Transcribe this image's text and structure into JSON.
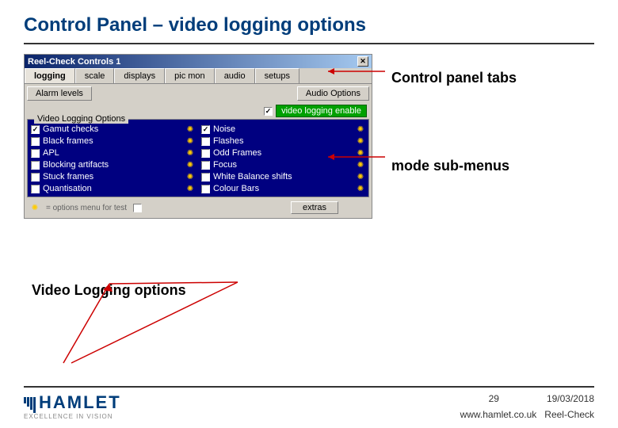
{
  "title": "Control Panel – video logging options",
  "window": {
    "title": "Reel-Check Controls 1",
    "close": "✕"
  },
  "tabs": [
    "logging",
    "scale",
    "displays",
    "pic mon",
    "audio",
    "setups"
  ],
  "active_tab_index": 0,
  "sub_buttons": {
    "alarm": "Alarm levels",
    "audio": "Audio Options"
  },
  "enable": {
    "label": "video logging enable",
    "checked": true
  },
  "group": {
    "label": "Video Logging Options"
  },
  "options_left": [
    {
      "label": "Gamut checks",
      "checked": true
    },
    {
      "label": "Black frames",
      "checked": false
    },
    {
      "label": "APL",
      "checked": false
    },
    {
      "label": "Blocking artifacts",
      "checked": false
    },
    {
      "label": "Stuck frames",
      "checked": false
    },
    {
      "label": "Quantisation",
      "checked": false
    }
  ],
  "options_right": [
    {
      "label": "Noise",
      "checked": true
    },
    {
      "label": "Flashes",
      "checked": false
    },
    {
      "label": "Odd Frames",
      "checked": false
    },
    {
      "label": "Focus",
      "checked": false
    },
    {
      "label": "White Balance shifts",
      "checked": false
    },
    {
      "label": "Colour Bars",
      "checked": false
    }
  ],
  "extras": {
    "hint": "= options menu for test",
    "btn": "extras"
  },
  "annotations": {
    "tabs": "Control panel tabs",
    "submenus": "mode sub-menus",
    "options": "Video Logging options"
  },
  "footer": {
    "logo": "HAMLET",
    "tagline": "EXCELLENCE IN VISION",
    "page": "29",
    "date": "19/03/2018",
    "url": "www.hamlet.co.uk",
    "product": "Reel-Check"
  }
}
